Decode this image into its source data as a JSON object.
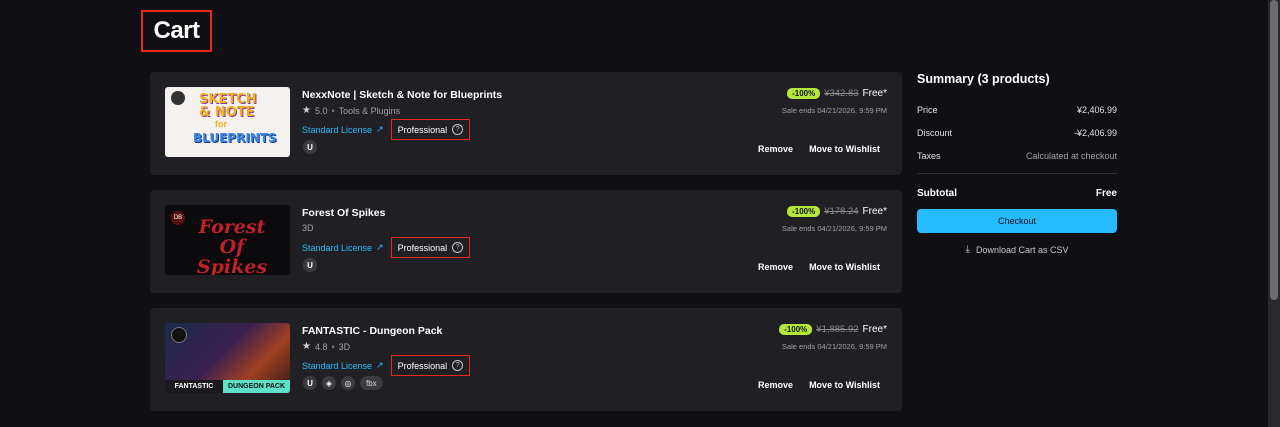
{
  "page": {
    "title": "Cart"
  },
  "items": [
    {
      "title": "NexxNote | Sketch & Note for Blueprints",
      "rating": "5.0",
      "category": "Tools & Plugins",
      "license_link": "Standard License",
      "license_type": "Professional",
      "discount": "-100%",
      "old_price": "¥342.83",
      "new_price": "Free*",
      "sale_ends": "Sale ends 04/21/2026, 9:59 PM",
      "remove": "Remove",
      "wishlist": "Move to Wishlist",
      "thumb_text": {
        "line1": "SKETCH",
        "line2": "& NOTE",
        "line3": "for",
        "line4": "BLUEPRINTS"
      },
      "platforms": [
        "unreal-engine-icon"
      ]
    },
    {
      "title": "Forest Of Spikes",
      "category": "3D",
      "license_link": "Standard License",
      "license_type": "Professional",
      "discount": "-100%",
      "old_price": "¥178.24",
      "new_price": "Free*",
      "sale_ends": "Sale ends 04/21/2026, 9:59 PM",
      "remove": "Remove",
      "wishlist": "Move to Wishlist",
      "thumb_text": {
        "line1": "Forest",
        "line2": "Of Spikes",
        "logo": "DB"
      },
      "platforms": [
        "unreal-engine-icon"
      ]
    },
    {
      "title": "FANTASTIC - Dungeon Pack",
      "rating": "4.8",
      "category": "3D",
      "license_link": "Standard License",
      "license_type": "Professional",
      "discount": "-100%",
      "old_price": "¥1,885.92",
      "new_price": "Free*",
      "sale_ends": "Sale ends 04/21/2026, 9:59 PM",
      "remove": "Remove",
      "wishlist": "Move to Wishlist",
      "thumb_text": {
        "left": "FANTASTIC",
        "right": "DUNGEON PACK"
      },
      "platforms": [
        "unreal-engine-icon",
        "unity-icon",
        "blender-icon"
      ],
      "format_pill": "fbx"
    }
  ],
  "summary": {
    "title": "Summary (3 products)",
    "price_label": "Price",
    "price_value": "¥2,406.99",
    "discount_label": "Discount",
    "discount_value": "-¥2,406.99",
    "taxes_label": "Taxes",
    "taxes_value": "Calculated at checkout",
    "subtotal_label": "Subtotal",
    "subtotal_value": "Free",
    "checkout": "Checkout",
    "download": "Download Cart as CSV"
  },
  "colors": {
    "accent": "#26bbff",
    "discount_badge": "#b5e63a",
    "highlight_border": "#e8281e",
    "background": "#101014",
    "card": "#202024"
  }
}
